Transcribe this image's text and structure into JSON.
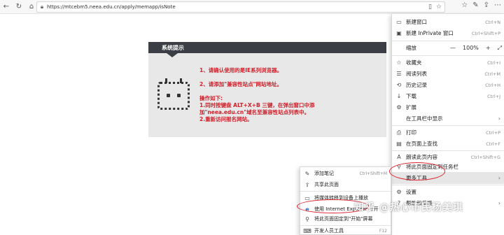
{
  "browser": {
    "url": "https://mtcebm5.neea.edu.cn/apply/memapp/isNote",
    "lock_icon": "lock-icon"
  },
  "notice": {
    "title": "系统提示",
    "line1": "1、请确认使用的是IE系列浏览器。",
    "line2": "2、请添加\"兼容性站点\"网站地址。",
    "line3": "操作如下:",
    "line4": "1.同时按键盘 ALT+X+B 三键，在弹出窗口中添",
    "line5": "加\"neea.edu.cn\"域名至兼容性站点列表中。",
    "line6": "2.重新访问报名网站。",
    "text_color": "#d0202a"
  },
  "menu": {
    "items": [
      {
        "label": "新建窗口",
        "shortcut": "Ctrl+N",
        "icon": "new-window-icon"
      },
      {
        "label": "新建 InPrivate 窗口",
        "shortcut": "Ctrl+Shift+P",
        "icon": "inprivate-icon"
      },
      {
        "label": "缩放",
        "zoom_value": "100%",
        "minus": "—",
        "plus": "+",
        "full": "⤢"
      },
      {
        "label": "收藏夹",
        "shortcut": "Ctrl+I",
        "icon": "favorites-icon"
      },
      {
        "label": "阅读列表",
        "shortcut": "Ctrl+M",
        "icon": "reading-list-icon"
      },
      {
        "label": "历史记录",
        "shortcut": "Ctrl+H",
        "icon": "history-icon"
      },
      {
        "label": "下载",
        "shortcut": "Ctrl+J",
        "icon": "download-icon"
      },
      {
        "label": "扩展",
        "shortcut": "",
        "icon": "extensions-icon"
      },
      {
        "label": "在工具栏中显示",
        "arrow": "›"
      },
      {
        "label": "打印",
        "shortcut": "Ctrl+P",
        "icon": "print-icon"
      },
      {
        "label": "在页面上查找",
        "shortcut": "Ctrl+F",
        "icon": "find-icon"
      },
      {
        "label": "朗读此页内容",
        "shortcut": "Ctrl+Shift+G",
        "icon": "read-aloud-icon"
      },
      {
        "label": "将此页面固定到任务栏",
        "shortcut": "",
        "icon": "pin-icon"
      },
      {
        "label": "更多工具",
        "arrow": "›"
      },
      {
        "label": "设置",
        "shortcut": "",
        "icon": "settings-icon"
      },
      {
        "label": "帮助和反馈",
        "arrow": "›",
        "icon": "help-icon"
      }
    ]
  },
  "submenu": {
    "items": [
      {
        "label": "添加笔记",
        "shortcut": "Ctrl+Shift+M",
        "icon": "pen-icon"
      },
      {
        "label": "共享此页面",
        "shortcut": "",
        "icon": "share-icon"
      },
      {
        "label": "将媒体转移到设备上播放",
        "shortcut": "",
        "icon": "cast-icon"
      },
      {
        "label": "使用 Internet Explorer 打开",
        "shortcut": "",
        "icon": "ie-icon"
      },
      {
        "label": "将此页面固定到\"开始\"屏幕",
        "shortcut": "",
        "icon": "pin-start-icon"
      },
      {
        "label": "开发人员工具",
        "shortcut": "F12",
        "icon": "devtools-icon"
      }
    ]
  },
  "watermark": "知乎 @热心市民杨美琪",
  "highlight_color": "#e0202a"
}
